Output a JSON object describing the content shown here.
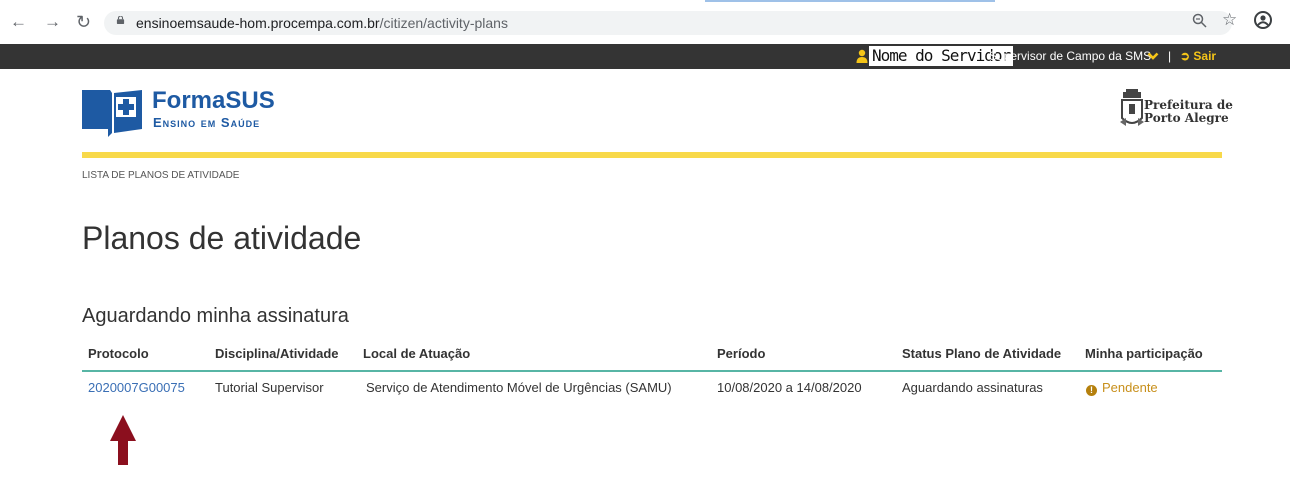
{
  "browser": {
    "url_host": "ensinoemsaude-hom.procempa.com.br",
    "url_path": "/citizen/activity-plans",
    "icons": [
      "back-icon",
      "forward-icon",
      "reload-icon",
      "lock-icon",
      "zoom-icon",
      "star-icon",
      "profile-icon"
    ]
  },
  "user_bar": {
    "server_name": "Nome do Servidor",
    "role": "Supervisor de Campo da SMS",
    "separator": "|",
    "logout": "Sair",
    "background": "#343434",
    "logout_color": "#f5c518"
  },
  "header": {
    "logo_name": "FormaSUS",
    "logo_subtitle": "Ensino em Saúde",
    "prefeitura_line1": "Prefeitura de",
    "prefeitura_line2": "Porto Alegre",
    "accent_color": "#f8d94a",
    "brand_color": "#1e5aa3"
  },
  "breadcrumb": "LISTA DE PLANOS DE ATIVIDADE",
  "page_title": "Planos de atividade",
  "section": {
    "title": "Aguardando minha assinatura",
    "columns": [
      "Protocolo",
      "Disciplina/Atividade",
      "Local de Atuação",
      "Período",
      "Status Plano de Atividade",
      "Minha participação"
    ],
    "rows": [
      {
        "protocolo": "2020007G00075",
        "disciplina": "Tutorial Supervisor",
        "local": "Serviço de Atendimento Móvel de Urgências (SAMU)",
        "periodo": "10/08/2020 a 14/08/2020",
        "status": "Aguardando assinaturas",
        "participacao": "Pendente"
      }
    ],
    "link_color": "#3a6fb5",
    "pending_color": "#c8901c",
    "rule_color": "#57b5a5"
  },
  "annotation": {
    "arrow_color": "#8b0f1e"
  }
}
